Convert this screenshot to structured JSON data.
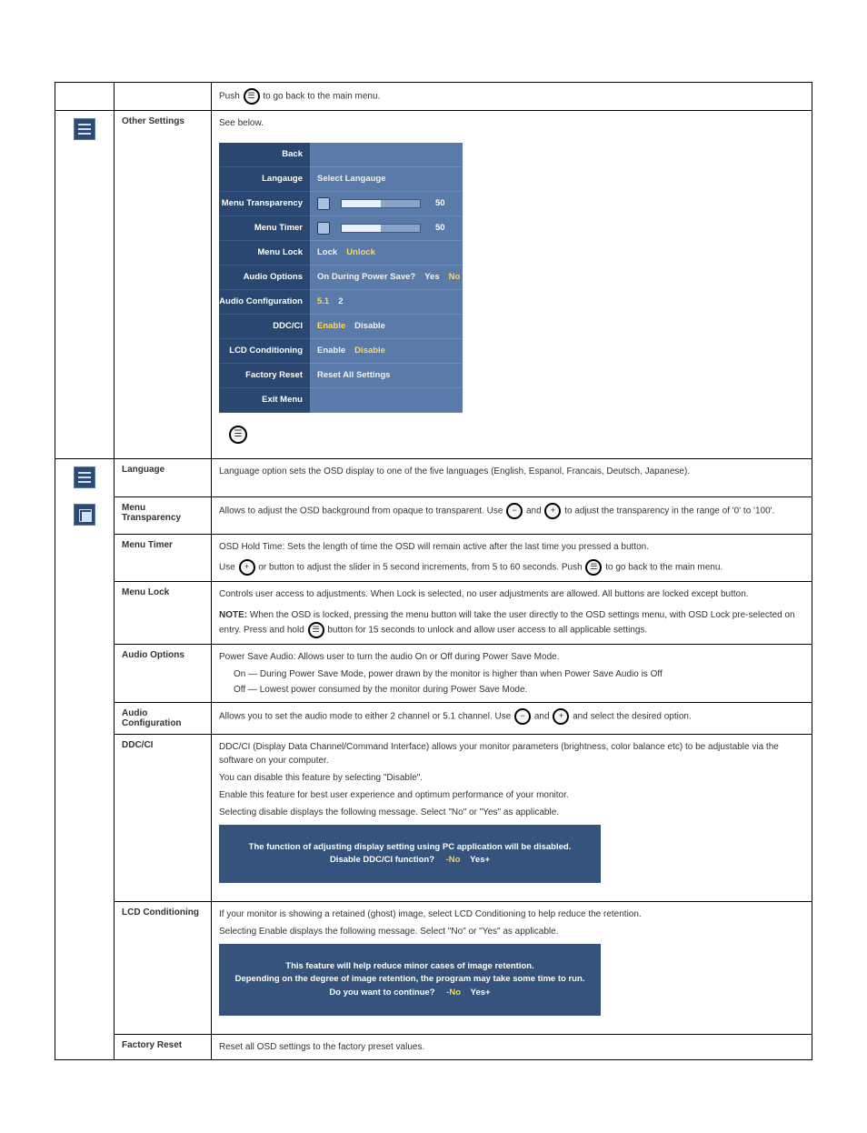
{
  "rows": {
    "blank_top": {
      "label": "",
      "desc_pre": "Push ",
      "desc_post": " to go back to the main menu."
    },
    "other_settings": {
      "label": "Other Settings",
      "desc": "See below."
    },
    "language": {
      "label": "Language",
      "desc": "Language option sets the OSD display to one of the five languages (English, Espanol, Francais, Deutsch, Japanese)."
    },
    "menu_transparency": {
      "label": "Menu Transparency",
      "desc_pre": "Allows to adjust the OSD background from opaque to transparent. Use ",
      "desc_mid": " and ",
      "desc_post": " to adjust the transparency in the range of '0' to '100'."
    },
    "menu_timer": {
      "label": "Menu Timer",
      "desc_line1": "OSD Hold Time: Sets the length of time the OSD will remain active after the last time you pressed a button.",
      "desc_line2_pre": "Use ",
      "desc_line2_post": " or button to adjust the slider in 5 second increments, from 5 to 60 seconds. Push ",
      "desc_line2_end": " to go back to the main menu."
    },
    "menu_lock": {
      "label": "Menu Lock",
      "desc_line1": "Controls user access to adjustments. When Lock is selected, no user adjustments are allowed. All buttons are locked except button.",
      "desc_note_label": "NOTE:",
      "desc_note_text_pre": " When the OSD is locked, pressing the menu button will take the user directly to the OSD settings menu, with OSD Lock pre-selected on entry. Press and hold ",
      "desc_note_text_post": " button for 15 seconds to unlock and allow user access to all applicable settings."
    },
    "audio_options": {
      "label": "Audio Options",
      "desc_line1": "Power Save Audio: Allows user to turn the audio On or Off during Power Save Mode.",
      "b1": "On — During Power Save Mode, power drawn by the monitor is higher than when Power Save Audio is Off",
      "b2": "Off  — Lowest power consumed by the monitor during Power Save Mode."
    },
    "audio_config": {
      "label": "Audio Configuration",
      "desc_pre": "Allows you to set the audio mode to either 2 channel or 5.1 channel. Use ",
      "desc_mid": " and ",
      "desc_post": " and select the desired option."
    },
    "ddcci": {
      "label": "DDC/CI",
      "desc_line1": "DDC/CI (Display Data Channel/Command Interface) allows your monitor parameters (brightness, color balance etc) to be adjustable via the software on your computer.",
      "desc_line2": "You can disable this feature by selecting \"Disable\".",
      "desc_line3": "Enable this feature for best user experience and optimum performance of your monitor.",
      "desc_line4": "Selecting disable displays the following message. Select \"No\" or \"Yes\" as applicable.",
      "warn_line1": "The function of adjusting display setting using PC application will be disabled.",
      "warn_line2": "Disable DDC/CI function?",
      "warn_no": "-No",
      "warn_yes": "Yes+"
    },
    "lcd": {
      "label": "LCD Conditioning",
      "desc_line1": "If your monitor is showing a retained (ghost) image, select LCD Conditioning to help reduce the retention.",
      "desc_line2": "Selecting Enable displays the following message. Select \"No\" or  \"Yes\" as applicable.",
      "warn_line1": "This feature will help reduce minor cases of image retention.",
      "warn_line2": "Depending on the degree of image retention, the program may take some time to run.",
      "warn_line3": "Do you want to continue?",
      "warn_no": "-No",
      "warn_yes": "Yes+"
    },
    "factory_reset": {
      "label": "Factory Reset",
      "desc": "Reset all OSD settings to the factory preset values."
    }
  },
  "osd": {
    "back": "Back",
    "language": {
      "label": "Langauge",
      "value": "Select Langauge"
    },
    "menu_transparency": {
      "label": "Menu Transparency",
      "value": "50"
    },
    "menu_timer": {
      "label": "Menu Timer",
      "value": "50"
    },
    "menu_lock": {
      "label": "Menu Lock",
      "lock": "Lock",
      "unlock": "Unlock"
    },
    "audio_options": {
      "label": "Audio Options",
      "q": "On During Power Save?",
      "yes": "Yes",
      "no": "No"
    },
    "audio_config": {
      "label": "Audio Configuration",
      "o1": "5.1",
      "o2": "2"
    },
    "ddcci": {
      "label": "DDC/CI",
      "enable": "Enable",
      "disable": "Disable"
    },
    "lcd": {
      "label": "LCD Conditioning",
      "enable": "Enable",
      "disable": "Disable"
    },
    "factory_reset": {
      "label": "Factory Reset",
      "value": "Reset All Settings"
    },
    "exit": "Exit Menu"
  }
}
